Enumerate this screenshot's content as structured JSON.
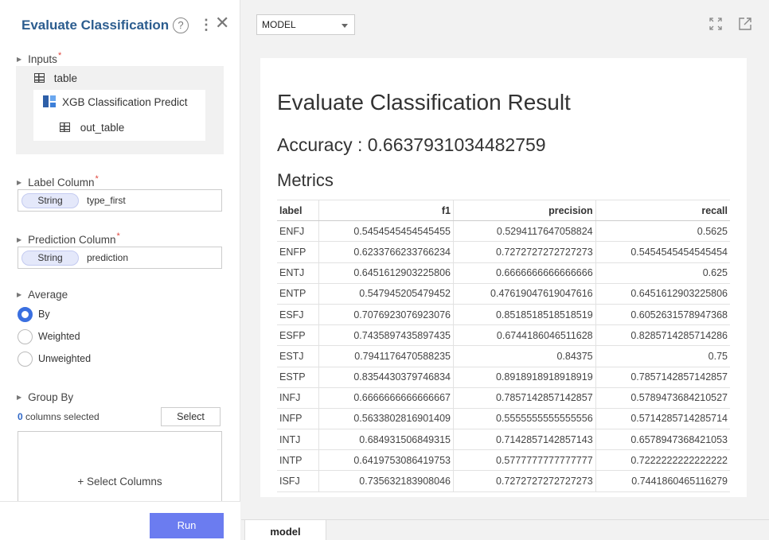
{
  "panel": {
    "title": "Evaluate Classification",
    "help_glyph": "?",
    "more_glyph": "⋮",
    "close_glyph": "✕"
  },
  "inputs": {
    "label": "Inputs",
    "required": "*",
    "table": "table",
    "node": "XGB Classification Predict",
    "out_table": "out_table"
  },
  "label_column": {
    "label": "Label Column",
    "required": "*",
    "type": "String",
    "value": "type_first"
  },
  "prediction_column": {
    "label": "Prediction Column",
    "required": "*",
    "type": "String",
    "value": "prediction"
  },
  "average": {
    "label": "Average",
    "options": [
      "By",
      "Weighted",
      "Unweighted"
    ],
    "selected": "By"
  },
  "group_by": {
    "label": "Group By",
    "count": "0",
    "count_suffix": " columns selected",
    "select_button": "Select",
    "select_columns": "+ Select Columns"
  },
  "run_button": "Run",
  "toolbar": {
    "model_select": "MODEL",
    "expand_icon": "expand-icon",
    "popout_icon": "popout-icon"
  },
  "result": {
    "title": "Evaluate Classification Result",
    "accuracy": "Accuracy : 0.6637931034482759",
    "metrics_heading": "Metrics",
    "columns": [
      "label",
      "f1",
      "precision",
      "recall"
    ],
    "rows": [
      [
        "ENFJ",
        "0.5454545454545455",
        "0.5294117647058824",
        "0.5625"
      ],
      [
        "ENFP",
        "0.6233766233766234",
        "0.7272727272727273",
        "0.5454545454545454"
      ],
      [
        "ENTJ",
        "0.6451612903225806",
        "0.6666666666666666",
        "0.625"
      ],
      [
        "ENTP",
        "0.547945205479452",
        "0.47619047619047616",
        "0.6451612903225806"
      ],
      [
        "ESFJ",
        "0.7076923076923076",
        "0.8518518518518519",
        "0.6052631578947368"
      ],
      [
        "ESFP",
        "0.7435897435897435",
        "0.6744186046511628",
        "0.8285714285714286"
      ],
      [
        "ESTJ",
        "0.7941176470588235",
        "0.84375",
        "0.75"
      ],
      [
        "ESTP",
        "0.8354430379746834",
        "0.8918918918918919",
        "0.7857142857142857"
      ],
      [
        "INFJ",
        "0.6666666666666667",
        "0.7857142857142857",
        "0.5789473684210527"
      ],
      [
        "INFP",
        "0.5633802816901409",
        "0.5555555555555556",
        "0.5714285714285714"
      ],
      [
        "INTJ",
        "0.684931506849315",
        "0.7142857142857143",
        "0.6578947368421053"
      ],
      [
        "INTP",
        "0.6419753086419753",
        "0.5777777777777777",
        "0.7222222222222222"
      ],
      [
        "ISFJ",
        "0.735632183908046",
        "0.7272727272727273",
        "0.7441860465116279"
      ]
    ]
  },
  "tabs": {
    "model": "model"
  },
  "colors": {
    "title_blue": "#2c5d8f",
    "run_button": "#6b7cf0",
    "radio_on": "#3a6fe0",
    "required": "#e0453d"
  }
}
